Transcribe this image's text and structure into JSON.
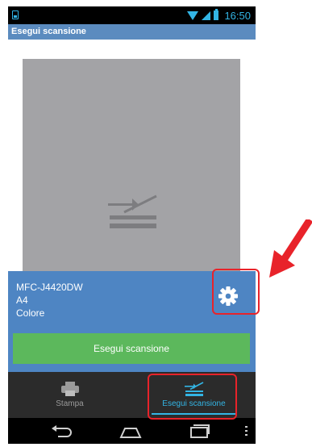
{
  "status_bar": {
    "time": "16:50",
    "icons": [
      "screenshot-icon",
      "wifi-icon",
      "signal-icon",
      "battery-icon"
    ],
    "accent_color": "#33b5e5"
  },
  "action_bar": {
    "title": "Esegui scansione",
    "color": "#5b8bbf"
  },
  "preview": {
    "icon": "scanner-icon",
    "background": "#a3a3a6"
  },
  "device_panel": {
    "device_name": "MFC-J4420DW",
    "paper_size": "A4",
    "color_mode": "Colore",
    "settings_icon": "gear-icon",
    "background": "#4e85c3"
  },
  "scan_button": {
    "label": "Esegui scansione",
    "color": "#5cb85c"
  },
  "tab_bar": {
    "tabs": [
      {
        "label": "Stampa",
        "icon": "printer-icon",
        "selected": false
      },
      {
        "label": "Esegui scansione",
        "icon": "scanner-icon",
        "selected": true
      }
    ]
  },
  "nav_bar": {
    "buttons": [
      "back-icon",
      "home-icon",
      "recent-apps-icon",
      "overflow-menu-icon"
    ]
  },
  "annotations": {
    "highlight_color": "#e8232a",
    "arrow_color": "#e8232a"
  }
}
